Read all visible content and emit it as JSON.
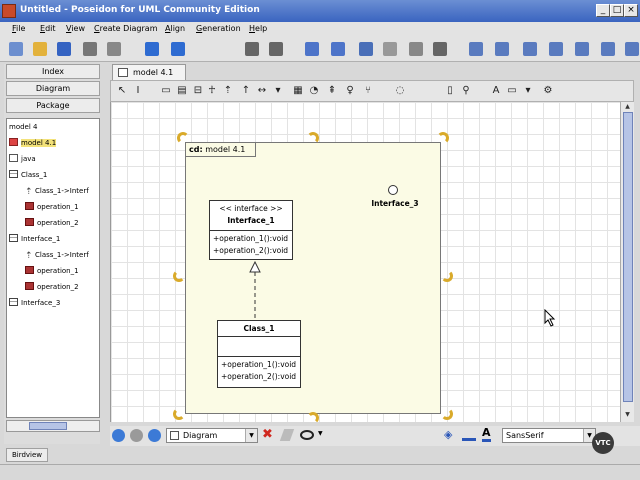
{
  "window": {
    "title": "Untitled - Poseidon for UML Community Edition",
    "controls": [
      "_",
      "□",
      "×"
    ]
  },
  "menu": [
    {
      "label": "File",
      "key": "F"
    },
    {
      "label": "Edit",
      "key": "E"
    },
    {
      "label": "View",
      "key": "V"
    },
    {
      "label": "Create Diagram",
      "key": "C"
    },
    {
      "label": "Align",
      "key": "A"
    },
    {
      "label": "Generation",
      "key": "G"
    },
    {
      "label": "Help",
      "key": "H"
    }
  ],
  "toolbar_icons": [
    "new-file-icon",
    "open-file-icon",
    "save-icon",
    "print-icon",
    "settings-icon",
    "undo-icon",
    "redo-icon",
    "link-icon",
    "unlink-icon",
    "cut-icon",
    "scissors-icon",
    "copy-icon",
    "paste-icon",
    "delete-icon",
    "camera-icon",
    "class-diagram-icon",
    "usecase-diagram-icon",
    "sequence-diagram-icon",
    "collaboration-diagram-icon",
    "state-diagram-icon",
    "activity-diagram-icon",
    "deployment-diagram-icon"
  ],
  "colors": {
    "title_bar": "#3a64c0",
    "frame_fill": "#fbfbe5",
    "handle": "#d9aa2a",
    "selection": "#f3e27a"
  },
  "navigator": {
    "tabs": [
      "Index",
      "Diagram",
      "Package"
    ],
    "tree": [
      {
        "label": "model 4",
        "icon": "",
        "indent": 0
      },
      {
        "label": "model 4.1",
        "icon": "model-icon",
        "indent": 0,
        "selected": true
      },
      {
        "label": "java",
        "icon": "folder-icon",
        "indent": 0
      },
      {
        "label": "Class_1",
        "icon": "class-icon",
        "indent": 0
      },
      {
        "label": "Class_1->Interf",
        "icon": "generalization-icon",
        "indent": 1
      },
      {
        "label": "operation_1",
        "icon": "operation-icon",
        "indent": 1
      },
      {
        "label": "operation_2",
        "icon": "operation-icon",
        "indent": 1
      },
      {
        "label": "Interface_1",
        "icon": "class-icon",
        "indent": 0
      },
      {
        "label": "Class_1->Interf",
        "icon": "generalization-icon",
        "indent": 1
      },
      {
        "label": "operation_1",
        "icon": "operation-icon",
        "indent": 1
      },
      {
        "label": "operation_2",
        "icon": "operation-icon",
        "indent": 1
      },
      {
        "label": "Interface_3",
        "icon": "class-icon",
        "indent": 0
      }
    ],
    "birdview_tab": "Birdview"
  },
  "diagram": {
    "tab_label": "model 4.1",
    "frame_prefix": "cd:",
    "frame_name": "model 4.1",
    "interface_1": {
      "stereotype": "<< interface >>",
      "name": "Interface_1",
      "operations": [
        "+operation_1():void",
        "+operation_2():void"
      ]
    },
    "class_1": {
      "name": "Class_1",
      "operations": [
        "+operation_1():void",
        "+operation_2():void"
      ]
    },
    "interface_3": {
      "name": "Interface_3"
    }
  },
  "bottom": {
    "diagram_select": "Diagram",
    "font_select": "SansSerif"
  },
  "watermark": "VTC"
}
